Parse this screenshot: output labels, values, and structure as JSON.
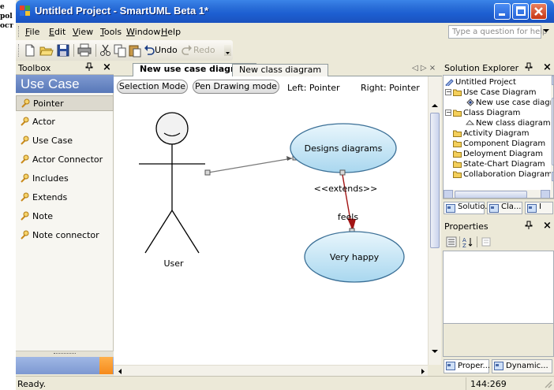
{
  "background_page": {
    "lines": [
      "e",
      "pol",
      "ост"
    ]
  },
  "window": {
    "title": "Untitled Project - SmartUML Beta 1*",
    "buttons": {
      "minimize": "_",
      "maximize": "□",
      "close": "✕"
    }
  },
  "menu": {
    "items": [
      {
        "key": "file",
        "label": "File",
        "mnemonic": "F",
        "rest": "ile"
      },
      {
        "key": "edit",
        "label": "Edit",
        "mnemonic": "E",
        "rest": "dit"
      },
      {
        "key": "view",
        "label": "View",
        "mnemonic": "V",
        "rest": "iew"
      },
      {
        "key": "tools",
        "label": "Tools",
        "mnemonic": "T",
        "rest": "ools"
      },
      {
        "key": "window",
        "label": "Window",
        "mnemonic": "W",
        "rest": "indow"
      },
      {
        "key": "help",
        "label": "Help",
        "mnemonic": "H",
        "rest": "elp"
      }
    ],
    "help_placeholder": "Type a question for help"
  },
  "toolbar": {
    "undo_label": "Undo",
    "redo_label": "Redo"
  },
  "toolbox": {
    "header": "Toolbox",
    "category": "Use Case",
    "items": [
      {
        "label": "Pointer",
        "selected": true
      },
      {
        "label": "Actor",
        "selected": false
      },
      {
        "label": "Use Case",
        "selected": false
      },
      {
        "label": "Actor Connector",
        "selected": false
      },
      {
        "label": "Includes",
        "selected": false
      },
      {
        "label": "Extends",
        "selected": false
      },
      {
        "label": "Note",
        "selected": false
      },
      {
        "label": "Note connector",
        "selected": false
      }
    ],
    "pin_glyph": "ꟸ",
    "close_glyph": "×"
  },
  "documents": {
    "tabs": [
      {
        "label": "New use case diagram",
        "active": true
      },
      {
        "label": "New class diagram",
        "active": false
      }
    ],
    "nav_glyphs": "◁ ▷ ×"
  },
  "canvas": {
    "selection_mode_label": "Selection Mode",
    "pen_mode_label": "Pen Drawing mode",
    "left_status": "Left: Pointer",
    "right_status": "Right: Pointer",
    "actor_label": "User",
    "usecase1_label": "Designs diagrams",
    "usecase2_label": "Very happy",
    "extends_label": "<<extends>>",
    "feels_label": "feels",
    "colors": {
      "usecase_fill_top": "#e9f6fc",
      "usecase_fill_bottom": "#a9d7ef",
      "usecase_stroke": "#3a6f96",
      "extends_arrow": "#a31414",
      "association_line": "#7a7a7a"
    }
  },
  "solution_explorer": {
    "header": "Solution Explorer",
    "tree": [
      {
        "label": "Untitled Project",
        "level": 0,
        "kind": "project"
      },
      {
        "label": "Use Case Diagram",
        "level": 1,
        "kind": "folder",
        "expanded": true
      },
      {
        "label": "New use case diagr",
        "level": 2,
        "kind": "usecase-diagram"
      },
      {
        "label": "Class Diagram",
        "level": 1,
        "kind": "folder",
        "expanded": true
      },
      {
        "label": "New class diagram",
        "level": 2,
        "kind": "class-diagram"
      },
      {
        "label": "Activity Diagram",
        "level": 1,
        "kind": "folder"
      },
      {
        "label": "Component Diagram",
        "level": 1,
        "kind": "folder"
      },
      {
        "label": "Deloyment Diagram",
        "level": 1,
        "kind": "folder"
      },
      {
        "label": "State-Chart Diagram",
        "level": 1,
        "kind": "folder"
      },
      {
        "label": "Collaboration Diagram",
        "level": 1,
        "kind": "folder"
      }
    ],
    "tabs": [
      {
        "label": "Solutio..."
      },
      {
        "label": "Cla..."
      },
      {
        "label": "I"
      }
    ]
  },
  "properties": {
    "header": "Properties",
    "bottom_tabs": [
      {
        "label": "Proper..."
      },
      {
        "label": "Dynamic..."
      }
    ]
  },
  "status": {
    "text": "Ready.",
    "coords": "144:269"
  }
}
